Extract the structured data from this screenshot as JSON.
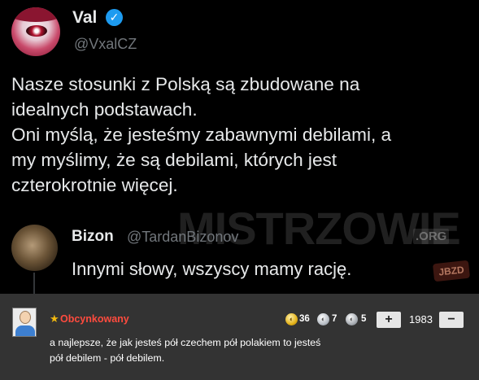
{
  "tweet": {
    "author_name": "Val",
    "verified_icon": "verified-badge-icon",
    "author_handle": "@VxalCZ",
    "text_lines": [
      "Nasze stosunki z Polską są zbudowane na",
      "idealnych podstawach.",
      "Oni myślą, że jesteśmy zabawnymi debilami, a",
      "my myślimy, że są debilami, których jest",
      "czterokrotnie więcej."
    ],
    "reply": {
      "author_name": "Bizon",
      "author_handle": "@TardanBizonov",
      "text": "Innymi słowy, wszyscy mamy rację."
    }
  },
  "watermark": {
    "text": "MISTRZOWIE",
    "suffix": ".ORG",
    "badge": "JBZD"
  },
  "comment": {
    "star_icon": "★",
    "username": "Obcynkowany",
    "coins": {
      "gold": "36",
      "silver": "7",
      "bronze": "5"
    },
    "vote_up": "+",
    "score": "1983",
    "vote_down": "−",
    "text_lines": [
      "a najlepsze, że jak jesteś pół czechem pół polakiem to jesteś",
      "pół debilem - pół debilem."
    ]
  },
  "colors": {
    "background": "#000000",
    "comment_bar": "#333333",
    "username": "#ff4b3e",
    "verified": "#1d9bf0"
  }
}
